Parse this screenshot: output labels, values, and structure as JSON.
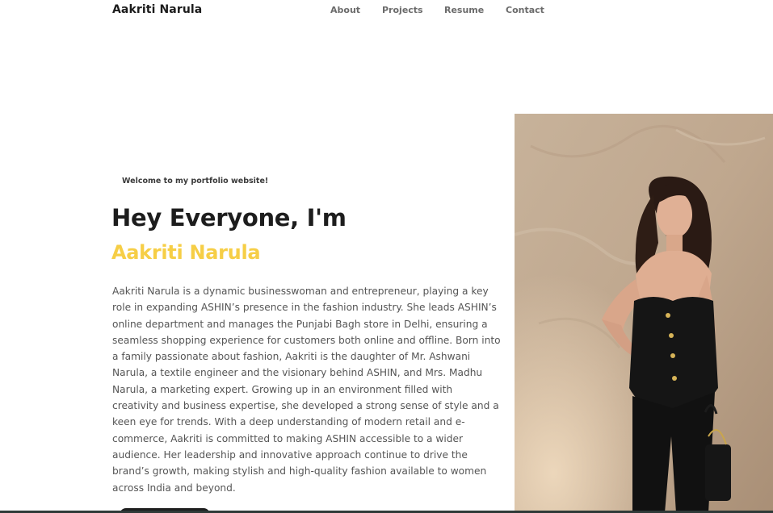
{
  "nav": {
    "brand": "Aakriti Narula",
    "links": [
      "About",
      "Projects",
      "Resume",
      "Contact"
    ]
  },
  "hero": {
    "welcome": "Welcome to my portfolio website!",
    "title": "Hey Everyone, I'm",
    "name": "Aakriti Narula",
    "bio": "Aakriti Narula is a dynamic businesswoman and entrepreneur, playing a key role in expanding ASHIN’s presence in the fashion industry. She leads ASHIN’s online department and manages the Punjabi Bagh store in Delhi, ensuring a seamless shopping experience for customers both online and offline. Born into a family passionate about fashion, Aakriti is the daughter of Mr. Ashwani Narula, a textile engineer and the visionary behind ASHIN, and Mrs. Madhu Narula, a marketing expert. Growing up in an environment filled with creativity and business expertise, she developed a strong sense of style and a keen eye for trends. With a deep understanding of modern retail and e-commerce, Aakriti is committed to making ASHIN accessible to a wider audience. Her leadership and innovative approach continue to drive the brand’s growth, making stylish and high-quality fashion available to women across India and beyond."
  },
  "colors": {
    "accent": "#f6ce46",
    "text_dark": "#1d1d1d",
    "text_body": "#555555",
    "nav_link": "#6b6b6b",
    "background": "#ffffff"
  }
}
